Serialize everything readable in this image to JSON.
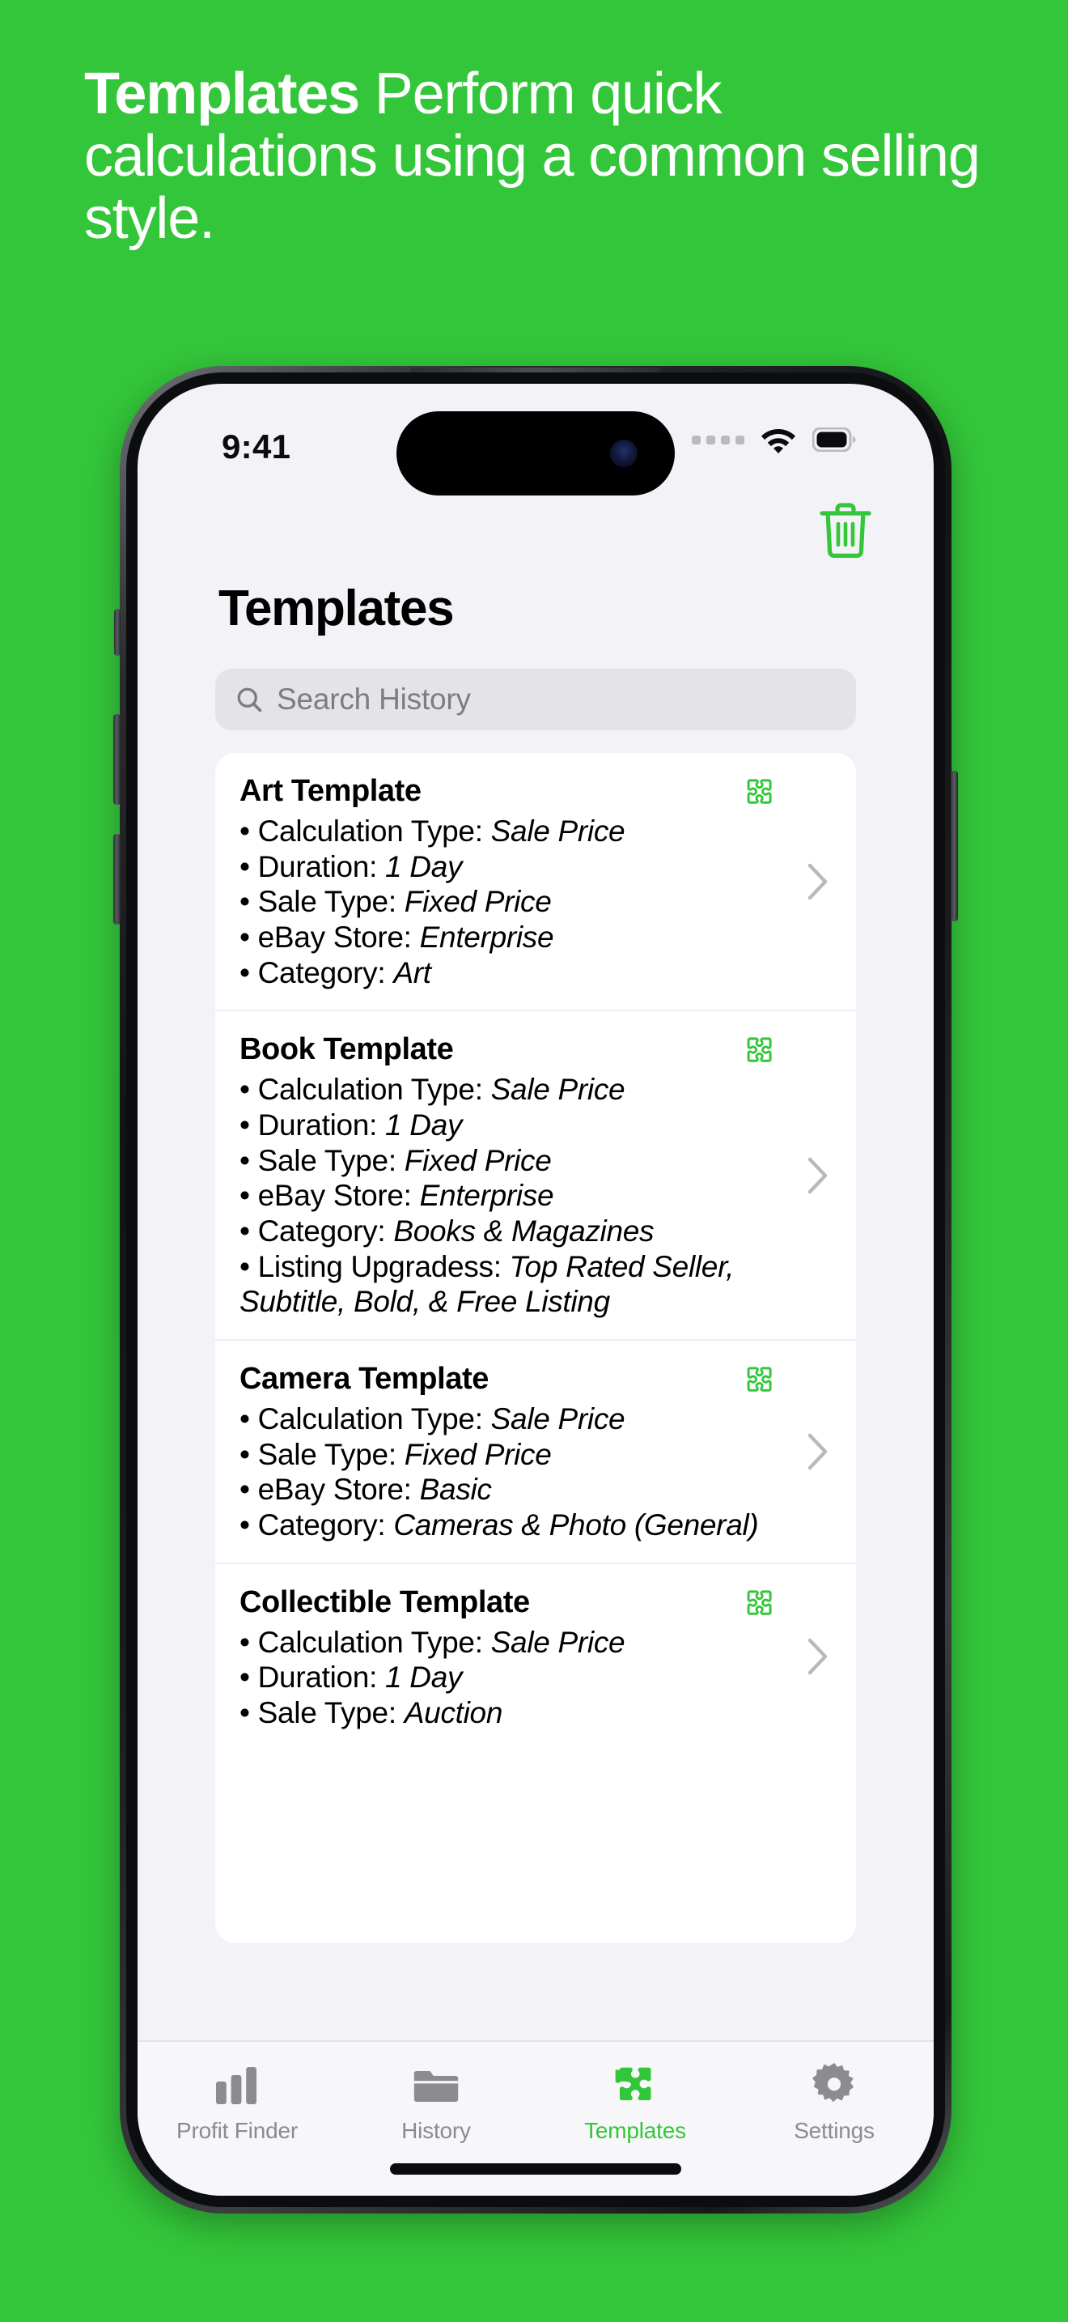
{
  "promo": {
    "bold_part": "Templates",
    "rest": " Perform quick calculations using a common selling style."
  },
  "colors": {
    "background_green": "#34C63A",
    "accent_green": "#34C63A",
    "screen_bg": "#f2f2f7",
    "card_bg": "#ffffff",
    "search_bg": "#e3e3e8",
    "muted_text": "#8b8b90"
  },
  "status_bar": {
    "time": "9:41",
    "cellular_icon": "cellular-dots-icon",
    "wifi_icon": "wifi-icon",
    "battery_icon": "battery-icon"
  },
  "app": {
    "delete_icon": "trash-icon",
    "nav_title": "Templates",
    "search": {
      "placeholder": "Search History",
      "value": "",
      "icon": "search-icon"
    },
    "badge_icon": "puzzle-piece-icon",
    "chevron_icon": "chevron-right-icon",
    "templates": [
      {
        "title": "Art Template",
        "lines": [
          {
            "label": "Calculation Type:",
            "value": "Sale Price"
          },
          {
            "label": "Duration:",
            "value": "1 Day"
          },
          {
            "label": "Sale Type:",
            "value": "Fixed Price"
          },
          {
            "label": "eBay Store:",
            "value": "Enterprise"
          },
          {
            "label": "Category:",
            "value": "Art"
          }
        ]
      },
      {
        "title": "Book Template",
        "lines": [
          {
            "label": "Calculation Type:",
            "value": "Sale Price"
          },
          {
            "label": "Duration:",
            "value": "1 Day"
          },
          {
            "label": "Sale Type:",
            "value": "Fixed Price"
          },
          {
            "label": "eBay Store:",
            "value": "Enterprise"
          },
          {
            "label": "Category:",
            "value": "Books & Magazines"
          },
          {
            "label": "Listing Upgradess:",
            "value": "Top Rated Seller, Subtitle, Bold, & Free Listing"
          }
        ]
      },
      {
        "title": "Camera Template",
        "lines": [
          {
            "label": "Calculation Type:",
            "value": "Sale Price"
          },
          {
            "label": "Sale Type:",
            "value": "Fixed Price"
          },
          {
            "label": "eBay Store:",
            "value": "Basic"
          },
          {
            "label": "Category:",
            "value": "Cameras & Photo (General)"
          }
        ]
      },
      {
        "title": "Collectible Template",
        "lines": [
          {
            "label": "Calculation Type:",
            "value": "Sale Price"
          },
          {
            "label": "Duration:",
            "value": "1 Day"
          },
          {
            "label": "Sale Type:",
            "value": "Auction"
          }
        ]
      }
    ],
    "tabs": [
      {
        "label": "Profit Finder",
        "icon": "bar-chart-icon",
        "active": false
      },
      {
        "label": "History",
        "icon": "folder-icon",
        "active": false
      },
      {
        "label": "Templates",
        "icon": "puzzle-piece-icon",
        "active": true
      },
      {
        "label": "Settings",
        "icon": "gear-icon",
        "active": false
      }
    ]
  }
}
